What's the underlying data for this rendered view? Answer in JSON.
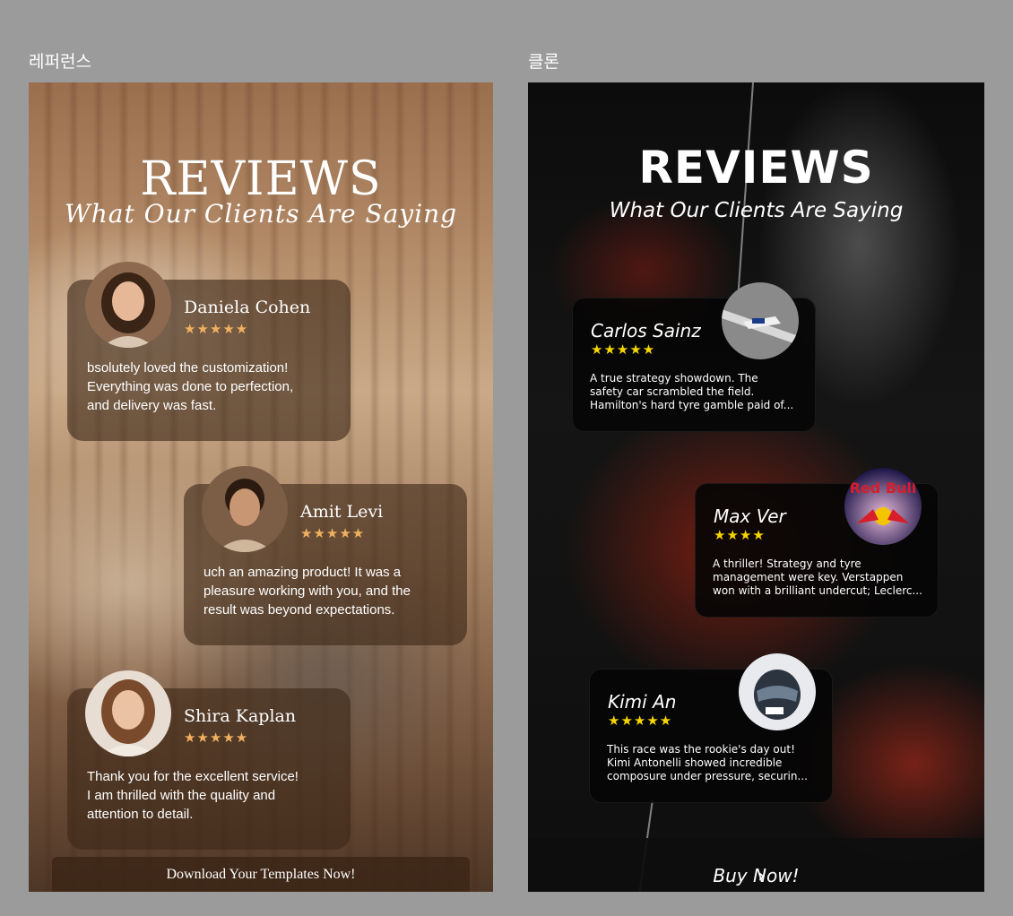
{
  "labels": {
    "reference": "레퍼런스",
    "clone": "클론"
  },
  "reference_panel": {
    "title": "REVIEWS",
    "subtitle": "What Our Clients Are Saying",
    "reviews": [
      {
        "name": "Daniela Cohen",
        "stars": "★★★★★",
        "lines": [
          "bsolutely loved the customization!",
          "Everything was done to perfection,",
          "and delivery was fast."
        ]
      },
      {
        "name": "Amit Levi",
        "stars": "★★★★★",
        "lines": [
          "uch an amazing product! It was a",
          "pleasure working with you, and the",
          "result was beyond expectations."
        ]
      },
      {
        "name": "Shira Kaplan",
        "stars": "★★★★★",
        "lines": [
          "Thank you for the excellent service!",
          "I am thrilled with the quality and",
          "attention to detail."
        ]
      }
    ],
    "cta": "Download Your Templates Now!"
  },
  "clone_panel": {
    "title": "REVIEWS",
    "subtitle": "What Our Clients Are Saying",
    "reviews": [
      {
        "name": "Carlos Sainz",
        "stars": "★★★★★",
        "lines": [
          "A true strategy showdown. The",
          "safety car scrambled the field.",
          "Hamilton's hard tyre gamble paid of..."
        ]
      },
      {
        "name": "Max Ver",
        "stars": "★★★★",
        "avatar_text": "Red Bull",
        "lines": [
          "A thriller! Strategy and tyre",
          "management were key. Verstappen",
          "won with a brilliant undercut; Leclerc..."
        ]
      },
      {
        "name": "Kimi An",
        "stars": "★★★★★",
        "lines": [
          "This race was the rookie's day out!",
          "Kimi Antonelli showed incredible",
          "composure under pressure, securin..."
        ]
      }
    ],
    "cta": "Buy Now!",
    "cta_icon": "chevron-right-icon"
  },
  "colors": {
    "reference_star": "#f0b060",
    "clone_star": "#f5d600",
    "canvas": "#9b9b9b"
  }
}
